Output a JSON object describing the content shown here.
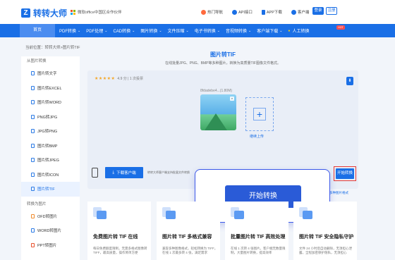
{
  "header": {
    "logo_text": "转转大师",
    "partner_text": "微软office中国区合作伙伴",
    "links": [
      {
        "label": "热门导航",
        "icon": "fire-icon"
      },
      {
        "label": "API接口",
        "icon": "api-icon"
      },
      {
        "label": "APP下载",
        "icon": "phone-icon"
      },
      {
        "label": "客户端",
        "icon": "download-icon"
      }
    ],
    "login_label": "登录",
    "register_label": "注册"
  },
  "nav": {
    "home": "首页",
    "items": [
      "PDF转换",
      "PDF处理",
      "CAD转换",
      "图片转换",
      "文件压缩",
      "电子书转换",
      "音视频转换",
      "客户端下载",
      "人工转换"
    ],
    "hot_badge": "HOT"
  },
  "breadcrumb": "当前位置：转转大师>图片转TIF",
  "sidebar": {
    "section1": "从图片转换",
    "items": [
      "图片转文字",
      "图片转EXCEL",
      "图片转WORD",
      "PNG转JPG",
      "JPG转PNG",
      "图片转BMP",
      "图片转JPEG",
      "图片转ICON",
      "图片转TIF"
    ],
    "active_index": 8,
    "section2": "转换为图片",
    "items2": [
      "OFD转图片",
      "WORD转图片",
      "PPT转图片"
    ]
  },
  "main": {
    "title": "图片转TIF",
    "subtitle": "在线批量JPG、PNG、BMP等多种图片，转换为高质量TIF图像文件格式。",
    "rating_stars": "★★★★★",
    "rating_text": "4.9 分 | 1 次投票",
    "file_name": "8fdadebe4...(1.80M)",
    "continue_upload": "继续上传",
    "download_button": "下载客户端",
    "note": "转转大师客户端支持批量文件转换",
    "convert_button": "开始转换",
    "support_link": "支持多种图片格式"
  },
  "popup": {
    "button_label": "开始转换"
  },
  "cards": [
    {
      "title": "免费图片转 TIF 在线",
      "desc": "每日免费额度限制，无需多格式图像转 TIFF，最高质量，操作简单方便"
    },
    {
      "title": "图片转 TIF 多格式兼容",
      "desc": "兼容多种图像格式，轻松转换为 TIFF，在线 1 次最多转 4 张，满足需求"
    },
    {
      "title": "批量图片转 TIF 高效处理",
      "desc": "在线 1 次转 4 张图片，客户端无数量限制，大量图片转换，提高效率"
    },
    {
      "title": "图片转 TIF 安全隐私守护",
      "desc": "文件 24 小时后自动删除，无须担心泄露，全程加密保护隐私，无须担心"
    }
  ],
  "colors": {
    "brand": "#1a6fe6",
    "highlight": "#e53935",
    "popup_border": "#3b57e8"
  }
}
